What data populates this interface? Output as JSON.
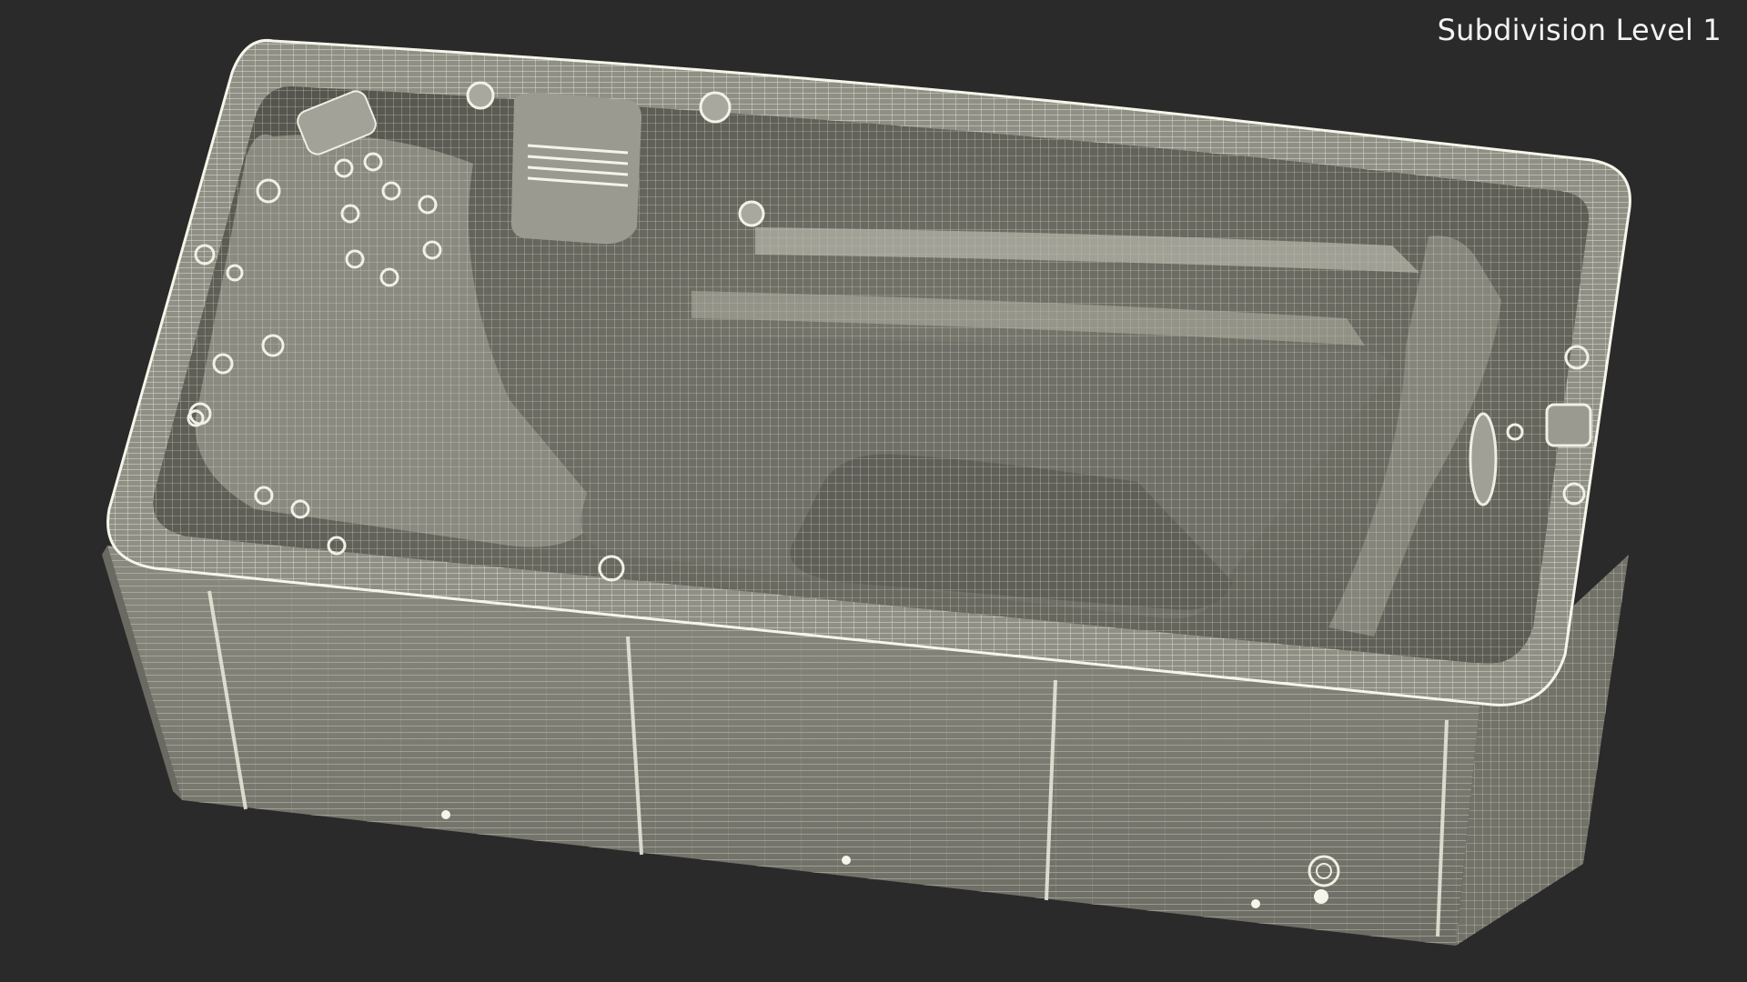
{
  "viewport": {
    "overlay_label": "Subdivision Level 1",
    "background_color": "#2a2a2a",
    "wire_color": "#e9e9dd",
    "shade_color": "#6a6a62"
  },
  "subject": {
    "icon": "wireframe-spa-model"
  }
}
